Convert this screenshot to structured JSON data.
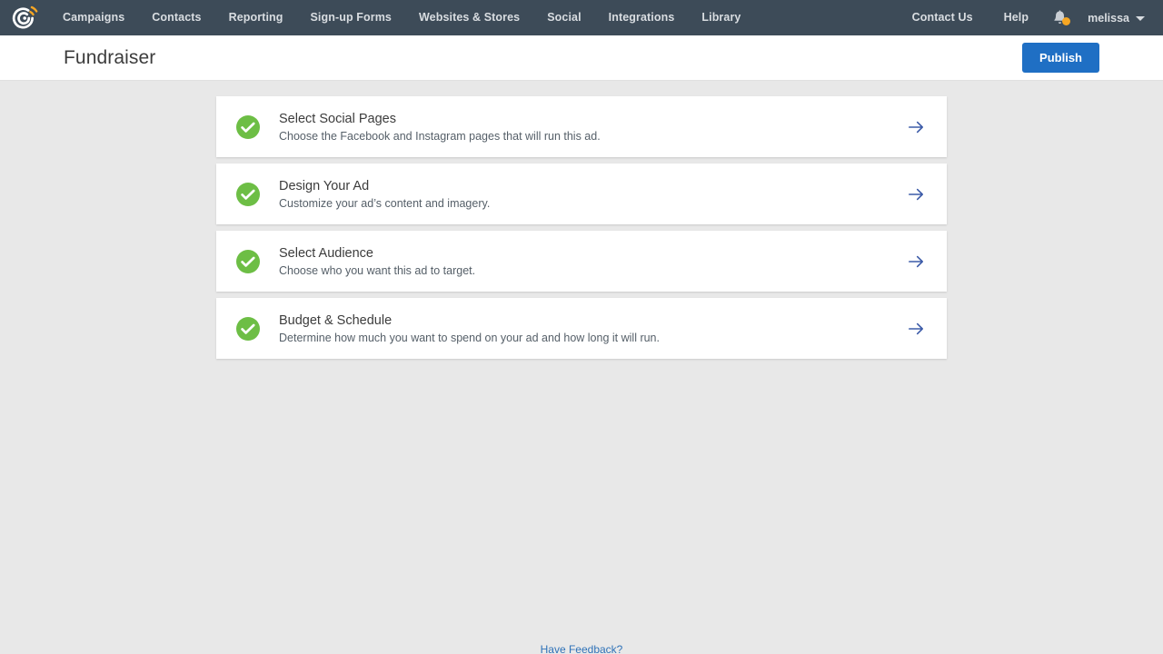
{
  "nav": {
    "logo_icon": "constant-contact-logo-icon",
    "links": [
      {
        "label": "Campaigns"
      },
      {
        "label": "Contacts"
      },
      {
        "label": "Reporting"
      },
      {
        "label": "Sign-up Forms"
      },
      {
        "label": "Websites & Stores"
      },
      {
        "label": "Social"
      },
      {
        "label": "Integrations"
      },
      {
        "label": "Library"
      }
    ],
    "right_links": [
      {
        "label": "Contact Us"
      },
      {
        "label": "Help"
      }
    ],
    "notifications_icon": "bell-icon",
    "has_notification_badge": true,
    "user": {
      "name": "melissa",
      "caret_icon": "chevron-down-icon"
    },
    "background_color": "#3d4b58",
    "link_color": "#d9dde1"
  },
  "header": {
    "title": "Fundraiser",
    "publish_label": "Publish",
    "publish_color": "#1f6fc4"
  },
  "main": {
    "steps": [
      {
        "status_icon": "check-circle-icon",
        "complete": true,
        "title": "Select Social Pages",
        "description": "Choose the Facebook and Instagram pages that will run this ad.",
        "arrow_icon": "arrow-right-icon"
      },
      {
        "status_icon": "check-circle-icon",
        "complete": true,
        "title": "Design Your Ad",
        "description": "Customize your ad’s content and imagery.",
        "arrow_icon": "arrow-right-icon"
      },
      {
        "status_icon": "check-circle-icon",
        "complete": true,
        "title": "Select Audience",
        "description": "Choose who you want this ad to target.",
        "arrow_icon": "arrow-right-icon"
      },
      {
        "status_icon": "check-circle-icon",
        "complete": true,
        "title": "Budget & Schedule",
        "description": "Determine how much you want to spend on your ad and how long it will run.",
        "arrow_icon": "arrow-right-icon"
      }
    ],
    "complete_color": "#6dbe45",
    "arrow_color": "#3c5ba8",
    "background_color": "#e8e8e8"
  },
  "footer": {
    "feedback_label": "Have Feedback?",
    "link_color": "#2f72b8"
  }
}
